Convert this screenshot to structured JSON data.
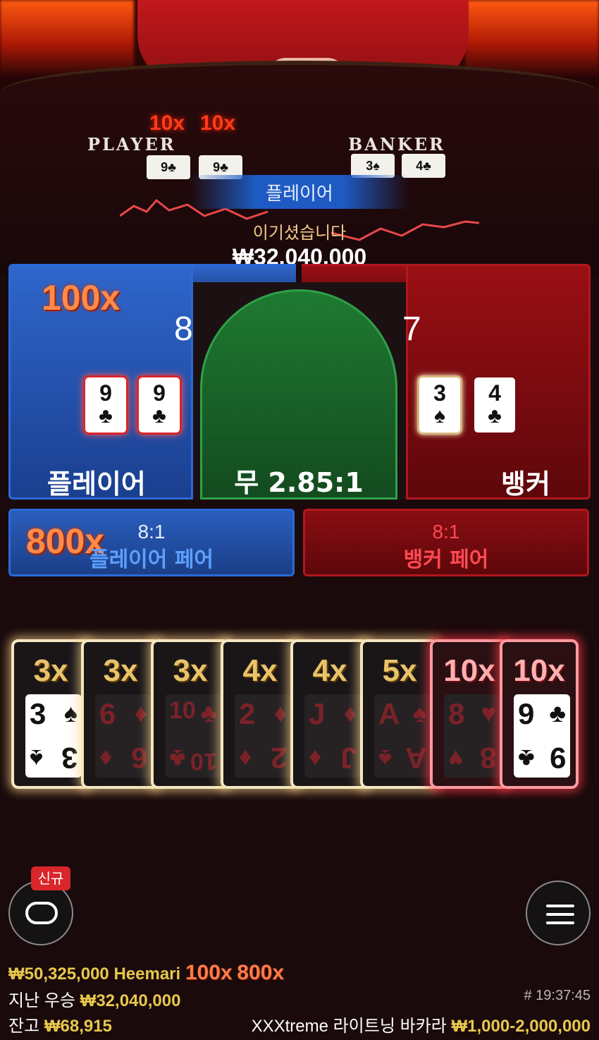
{
  "table": {
    "player_label": "PLAYER",
    "banker_label": "BANKER",
    "top_multipliers": [
      "10x",
      "10x"
    ],
    "player_mini_cards": [
      "9♣",
      "9♣"
    ],
    "banker_mini_cards": [
      "3♠",
      "4♣"
    ]
  },
  "result": {
    "winner_banner": "플레이어",
    "win_message": "이기셨습니다",
    "win_amount": "₩32,040,000"
  },
  "bets": {
    "player": {
      "multiplier": "100x",
      "score": "8",
      "cards": [
        {
          "rank": "9",
          "suit": "♣"
        },
        {
          "rank": "9",
          "suit": "♣"
        }
      ],
      "label": "플레이어"
    },
    "tie": {
      "label": "무 2.85:1"
    },
    "banker": {
      "score": "7",
      "cards": [
        {
          "rank": "3",
          "suit": "♠"
        },
        {
          "rank": "4",
          "suit": "♣"
        }
      ],
      "label": "뱅커"
    },
    "player_pair": {
      "multiplier": "800x",
      "odds": "8:1",
      "label": "플레이어 페어"
    },
    "banker_pair": {
      "odds": "8:1",
      "label": "뱅커 페어"
    }
  },
  "lightning_cards": [
    {
      "mult": "3x",
      "rank": "3",
      "suit": "♠",
      "style": "white"
    },
    {
      "mult": "3x",
      "rank": "6",
      "suit": "♦",
      "style": "dark"
    },
    {
      "mult": "3x",
      "rank": "10",
      "suit": "♣",
      "style": "dark"
    },
    {
      "mult": "4x",
      "rank": "2",
      "suit": "♦",
      "style": "dark"
    },
    {
      "mult": "4x",
      "rank": "J",
      "suit": "♦",
      "style": "dark"
    },
    {
      "mult": "5x",
      "rank": "A",
      "suit": "♠",
      "style": "dark"
    },
    {
      "mult": "10x",
      "rank": "8",
      "suit": "♥",
      "style": "dark-red"
    },
    {
      "mult": "10x",
      "rank": "9",
      "suit": "♣",
      "style": "white-red"
    }
  ],
  "controls": {
    "new_badge": "신규",
    "chat_icon": "chat-icon",
    "menu_icon": "hamburger-menu-icon"
  },
  "footer": {
    "top_winner_amount": "₩50,325,000",
    "top_winner_name": "Heemari",
    "top_winner_mult1": "100x",
    "top_winner_mult2": "800x",
    "last_win_label": "지난 우승",
    "last_win_amount": "₩32,040,000",
    "round_id": "# 19:37:45",
    "balance_label": "잔고",
    "balance_amount": "₩68,915",
    "game_name": "XXXtreme 라이트닝 바카라",
    "bet_limits": "₩1,000-2,000,000"
  },
  "colors": {
    "player_blue": "#2a6ad8",
    "banker_red": "#b0181e",
    "tie_green": "#2fa04a",
    "gold": "#e8c84a"
  }
}
